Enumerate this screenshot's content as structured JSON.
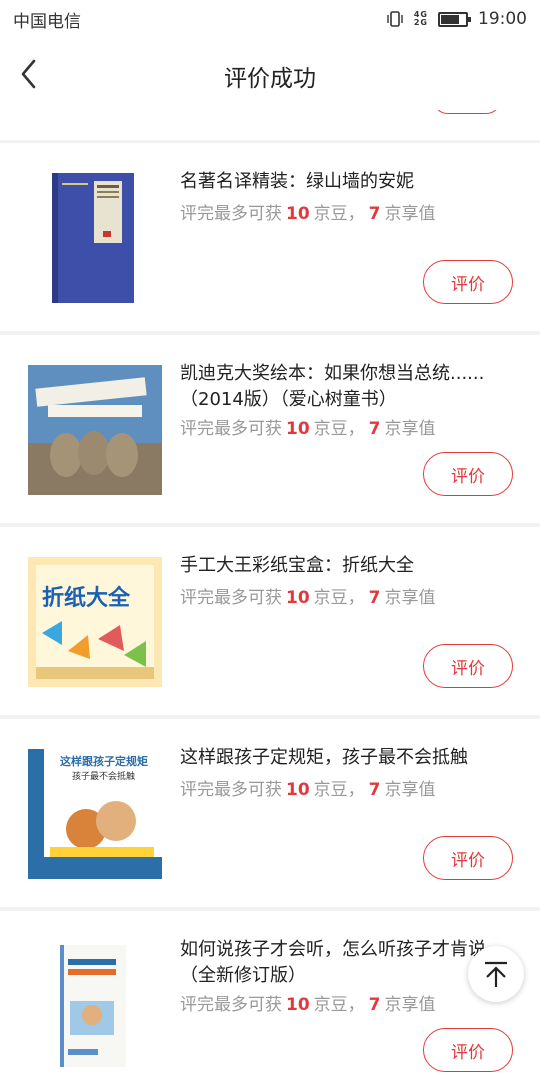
{
  "status_bar": {
    "carrier": "中国电信",
    "network_top": "4G",
    "network_bottom": "2G",
    "time": "19:00",
    "battery_level": 0.75
  },
  "header": {
    "title": "评价成功"
  },
  "items": [
    {
      "title": "名著名译精装：绿山墙的安妮",
      "reward_prefix": "评完最多可获",
      "beans": "10",
      "beans_unit": "京豆，",
      "value": "7",
      "value_unit": "京享值",
      "button": "评价"
    },
    {
      "title": "凯迪克大奖绘本：如果你想当总统......（2014版）（爱心树童书）",
      "reward_prefix": "评完最多可获",
      "beans": "10",
      "beans_unit": "京豆，",
      "value": "7",
      "value_unit": "京享值",
      "button": "评价"
    },
    {
      "title": "手工大王彩纸宝盒：折纸大全",
      "reward_prefix": "评完最多可获",
      "beans": "10",
      "beans_unit": "京豆，",
      "value": "7",
      "value_unit": "京享值",
      "button": "评价",
      "cover_text": "折纸大全"
    },
    {
      "title": "这样跟孩子定规矩，孩子最不会抵触",
      "reward_prefix": "评完最多可获",
      "beans": "10",
      "beans_unit": "京豆，",
      "value": "7",
      "value_unit": "京享值",
      "button": "评价",
      "cover_text": "这样跟孩子定规矩",
      "cover_subtext": "孩子最不会抵触"
    },
    {
      "title": "如何说孩子才会听，怎么听孩子才肯说（全新修订版）",
      "reward_prefix": "评完最多可获",
      "beans": "10",
      "beans_unit": "京豆，",
      "value": "7",
      "value_unit": "京享值",
      "button": "评价"
    }
  ],
  "colors": {
    "accent": "#e4393c",
    "muted": "#999999",
    "background": "#f2f2f2"
  },
  "icons": {
    "back": "chevron-left-icon",
    "to_top": "arrow-up-icon"
  }
}
